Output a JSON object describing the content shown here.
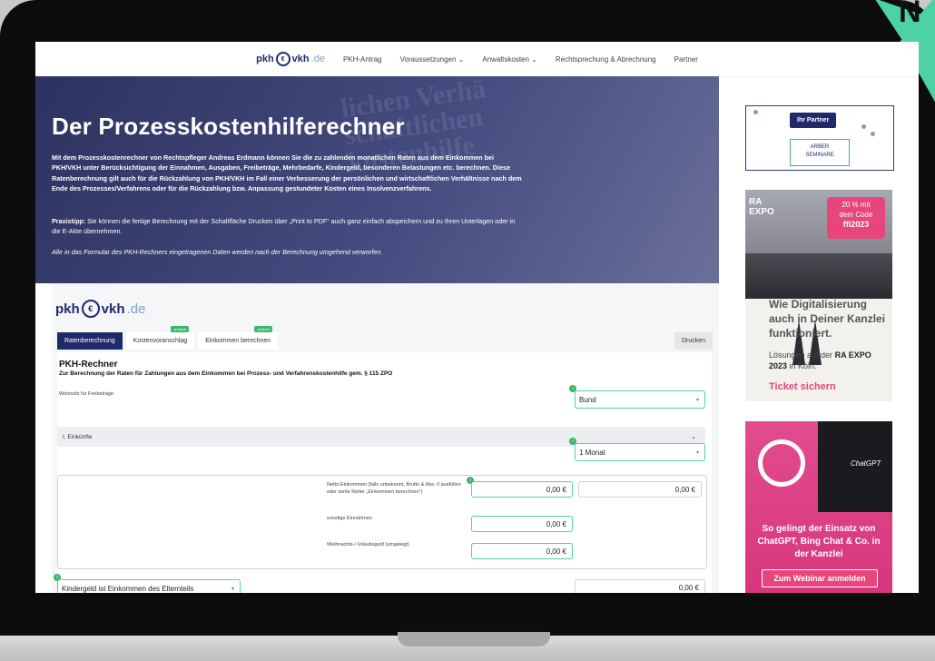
{
  "device_badge": "N",
  "nav": {
    "logo_main": "pkh",
    "logo_coin": "€",
    "logo_second": "vkh",
    "logo_tld": ".de",
    "items": [
      "PKH-Antrag",
      "Voraussetzungen ⌄",
      "Anwaltskosten ⌄",
      "Rechtsprechung & Abrechnung",
      "Partner"
    ]
  },
  "hero": {
    "bg_text_1": "lichen Verhä",
    "bg_text_2": "schaftlichen",
    "bg_text_3": "kostenhilfe",
    "title": "Der Prozesskostenhilferechner",
    "description": "Mit dem Prozesskostenrechner von Rechtspfleger Andreas Erdmann können Sie die zu zahlenden monatlichen Raten aus dem Einkommen bei PKH/VKH unter Berücksichtigung der Einnahmen, Ausgaben, Freibeträge, Mehrbedarfe, Kindergeld, besonderen Belastungen etc. berechnen. Diese Ratenberechnung gilt auch für die Rückzahlung von PKH/VKH im Fall einer Verbesserung der persönlichen und wirtschaftlichen Verhältnisse nach dem Ende des Prozesses/Verfahrens oder für die Rückzahlung bzw. Anpassung gestundeter Kosten eines Insolvenzverfahrens.",
    "tip_label": "Praxistipp:",
    "tip_text": "Sie können die fertige Berechnung mit der Schaltfläche Drucken über „Print to PDF“ auch ganz einfach abspeichern und zu Ihren Unterlagen oder in die E-Akte übernehmen.",
    "note": "Alle in das Formular des PKH-Rechners eingetragenen Daten werden nach der Berechnung umgehend verworfen."
  },
  "calc": {
    "tabs": [
      {
        "label": "Ratenberechnung",
        "badge": ""
      },
      {
        "label": "Kostenvoranschlag",
        "badge": "optional"
      },
      {
        "label": "Einkommen berechnen",
        "badge": "optional"
      }
    ],
    "print_label": "Drucken",
    "title": "PKH-Rechner",
    "subtitle": "Zur Berechnung der Raten für Zahlungen aus dem Einkommen bei Prozess- und Verfahrenskostenhilfe gem. § 115 ZPO",
    "wohnsitz_label": "Wohnsitz für Freibeträge",
    "wohnsitz_value": "Bund",
    "section_label": "I. Einkünfte",
    "period_value": "1 Monat",
    "netto_label": "Netto-Einkommen (falls unbekannt, Brutto & Abs. II ausfüllen oder siehe Reiter „Einkommen berechnen“)",
    "netto_value": "0,00 €",
    "netto_total": "0,00 €",
    "sonstige_label": "sonstige Einnahmen",
    "sonstige_value": "0,00 €",
    "weihnachts_label": "Weihnachts-/ Urlaubsgeld (umgelegt)",
    "weihnachts_value": "0,00 €",
    "kindergeld_value": "Kindergeld ist Einkommen des Elternteils",
    "kindergeld_amount": "0,00 €",
    "info_glyph": "i"
  },
  "sidebar": {
    "partner_button": "Ihr Partner",
    "arber_line1": "ARBER",
    "arber_line2": "SEMINARE",
    "ad1": {
      "brand_1": "RA",
      "brand_2": "EXPO",
      "promo_1": "20 % mit",
      "promo_2": "dem Code",
      "promo_code": "ffi2023",
      "heading": "Wie Digitalisierung auch in Deiner Kanzlei funktioniert.",
      "sub_1": "Lösungen auf der",
      "sub_bold": "RA EXPO 2023",
      "sub_2": "in Köln.",
      "cta": "Ticket sichern"
    },
    "ad2": {
      "screen_text": "ChatGPT",
      "title": "So gelingt der Einsatz von ChatGPT, Bing Chat & Co. in der Kanzlei",
      "button": "Zum Webinar anmelden"
    }
  }
}
